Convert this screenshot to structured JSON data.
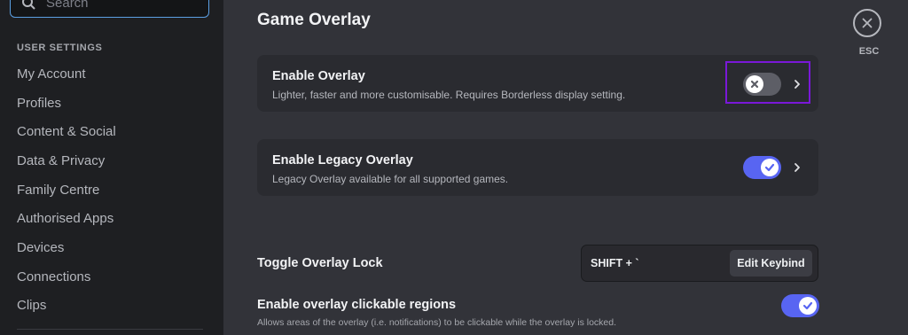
{
  "sidebar": {
    "search": {
      "placeholder": "Search"
    },
    "section_title": "USER SETTINGS",
    "items": [
      {
        "label": "My Account"
      },
      {
        "label": "Profiles"
      },
      {
        "label": "Content & Social"
      },
      {
        "label": "Data & Privacy"
      },
      {
        "label": "Family Centre"
      },
      {
        "label": "Authorised Apps"
      },
      {
        "label": "Devices"
      },
      {
        "label": "Connections"
      },
      {
        "label": "Clips"
      }
    ]
  },
  "main": {
    "title": "Game Overlay",
    "close": {
      "label": "ESC"
    },
    "enable_overlay": {
      "title": "Enable Overlay",
      "description": "Lighter, faster and more customisable. Requires Borderless display setting.",
      "enabled": false
    },
    "enable_legacy_overlay": {
      "title": "Enable Legacy Overlay",
      "description": "Legacy Overlay available for all supported games.",
      "enabled": true
    },
    "toggle_overlay_lock": {
      "label": "Toggle Overlay Lock",
      "keybind": "SHIFT + `",
      "edit_button": "Edit Keybind"
    },
    "clickable_regions": {
      "label": "Enable overlay clickable regions",
      "description": "Allows areas of the overlay (i.e. notifications) to be clickable while the overlay is locked.",
      "enabled": true
    }
  },
  "colors": {
    "accent": "#5865f2",
    "highlight_box": "#7a18d8",
    "toggle_off": "#5d5e66"
  }
}
